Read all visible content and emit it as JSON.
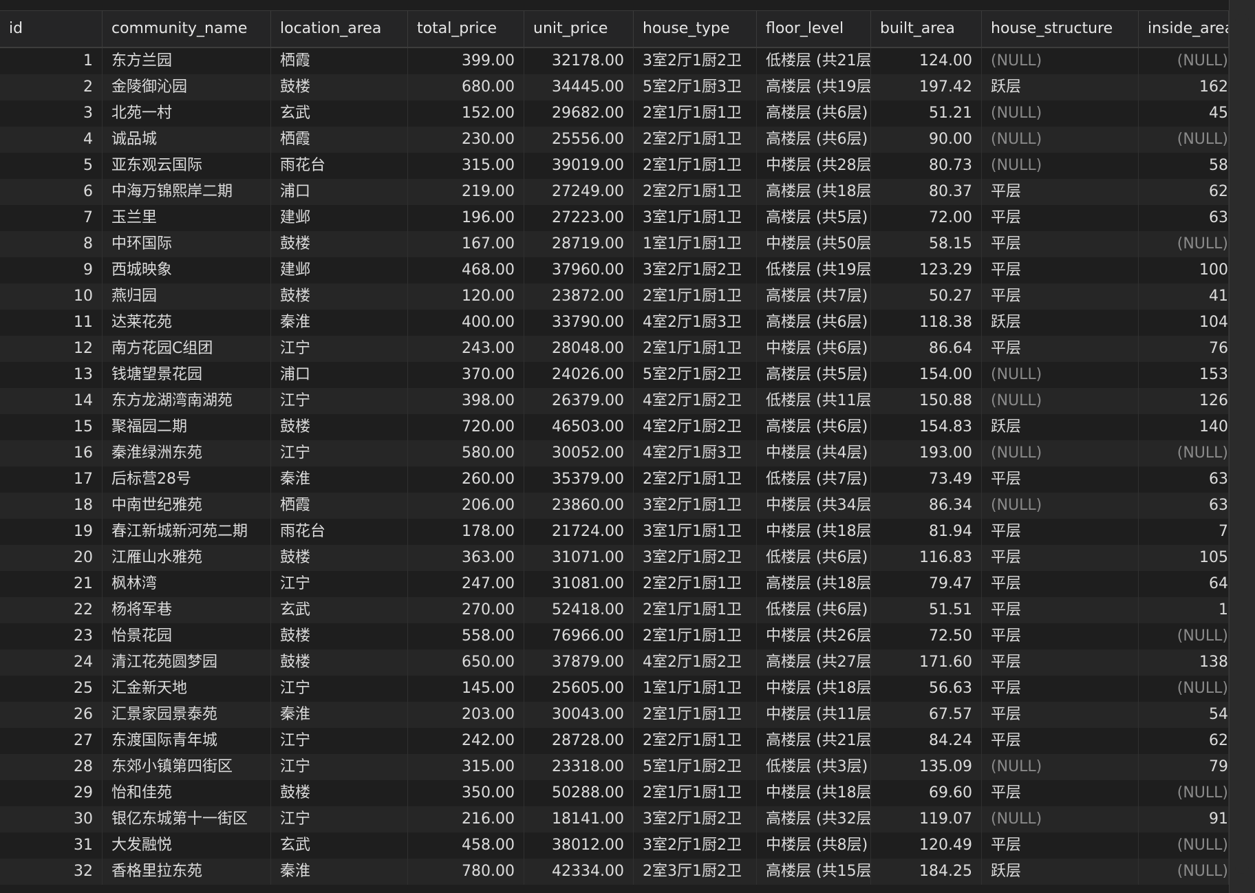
{
  "columns": [
    "id",
    "community_name",
    "location_area",
    "total_price",
    "unit_price",
    "house_type",
    "floor_level",
    "built_area",
    "house_structure",
    "inside_area"
  ],
  "rows": [
    [
      "1",
      "东方兰园",
      "栖霞",
      "399.00",
      "32178.00",
      "3室2厅1厨2卫",
      "低楼层 (共21层)",
      "124.00",
      "(NULL)",
      "(NULL)"
    ],
    [
      "2",
      "金陵御沁园",
      "鼓楼",
      "680.00",
      "34445.00",
      "5室2厅1厨3卫",
      "高楼层 (共19层)",
      "197.42",
      "跃层",
      "162"
    ],
    [
      "3",
      "北苑一村",
      "玄武",
      "152.00",
      "29682.00",
      "2室1厅1厨1卫",
      "高楼层 (共6层)",
      "51.21",
      "(NULL)",
      "45"
    ],
    [
      "4",
      "诚品城",
      "栖霞",
      "230.00",
      "25556.00",
      "2室2厅1厨1卫",
      "高楼层 (共6层)",
      "90.00",
      "(NULL)",
      "(NULL)"
    ],
    [
      "5",
      "亚东观云国际",
      "雨花台",
      "315.00",
      "39019.00",
      "2室1厅1厨1卫",
      "中楼层 (共28层)",
      "80.73",
      "(NULL)",
      "58"
    ],
    [
      "6",
      "中海万锦熙岸二期",
      "浦口",
      "219.00",
      "27249.00",
      "2室2厅1厨1卫",
      "高楼层 (共18层)",
      "80.37",
      "平层",
      "62"
    ],
    [
      "7",
      "玉兰里",
      "建邺",
      "196.00",
      "27223.00",
      "3室1厅1厨1卫",
      "高楼层 (共5层)",
      "72.00",
      "平层",
      "63"
    ],
    [
      "8",
      "中环国际",
      "鼓楼",
      "167.00",
      "28719.00",
      "1室1厅1厨1卫",
      "中楼层 (共50层)",
      "58.15",
      "平层",
      "(NULL)"
    ],
    [
      "9",
      "西城映象",
      "建邺",
      "468.00",
      "37960.00",
      "3室2厅1厨2卫",
      "低楼层 (共19层)",
      "123.29",
      "平层",
      "100"
    ],
    [
      "10",
      "燕归园",
      "鼓楼",
      "120.00",
      "23872.00",
      "2室1厅1厨1卫",
      "高楼层 (共7层)",
      "50.27",
      "平层",
      "41"
    ],
    [
      "11",
      "达莱花苑",
      "秦淮",
      "400.00",
      "33790.00",
      "4室2厅1厨3卫",
      "高楼层 (共6层)",
      "118.38",
      "跃层",
      "104"
    ],
    [
      "12",
      "南方花园C组团",
      "江宁",
      "243.00",
      "28048.00",
      "2室1厅1厨1卫",
      "中楼层 (共6层)",
      "86.64",
      "平层",
      "76"
    ],
    [
      "13",
      "钱塘望景花园",
      "浦口",
      "370.00",
      "24026.00",
      "5室2厅1厨2卫",
      "高楼层 (共5层)",
      "154.00",
      "(NULL)",
      "153"
    ],
    [
      "14",
      "东方龙湖湾南湖苑",
      "江宁",
      "398.00",
      "26379.00",
      "4室2厅1厨2卫",
      "低楼层 (共11层)",
      "150.88",
      "(NULL)",
      "126"
    ],
    [
      "15",
      "聚福园二期",
      "鼓楼",
      "720.00",
      "46503.00",
      "4室2厅1厨2卫",
      "高楼层 (共6层)",
      "154.83",
      "跃层",
      "140"
    ],
    [
      "16",
      "秦淮绿洲东苑",
      "江宁",
      "580.00",
      "30052.00",
      "4室2厅1厨3卫",
      "中楼层 (共4层)",
      "193.00",
      "(NULL)",
      "(NULL)"
    ],
    [
      "17",
      "后标营28号",
      "秦淮",
      "260.00",
      "35379.00",
      "2室2厅1厨1卫",
      "低楼层 (共7层)",
      "73.49",
      "平层",
      "63"
    ],
    [
      "18",
      "中南世纪雅苑",
      "栖霞",
      "206.00",
      "23860.00",
      "3室2厅1厨1卫",
      "中楼层 (共34层)",
      "86.34",
      "(NULL)",
      "63"
    ],
    [
      "19",
      "春江新城新河苑二期",
      "雨花台",
      "178.00",
      "21724.00",
      "3室1厅1厨1卫",
      "中楼层 (共18层)",
      "81.94",
      "平层",
      "7"
    ],
    [
      "20",
      "江雁山水雅苑",
      "鼓楼",
      "363.00",
      "31071.00",
      "3室2厅1厨2卫",
      "低楼层 (共6层)",
      "116.83",
      "平层",
      "105"
    ],
    [
      "21",
      "枫林湾",
      "江宁",
      "247.00",
      "31081.00",
      "2室2厅1厨1卫",
      "高楼层 (共18层)",
      "79.47",
      "平层",
      "64"
    ],
    [
      "22",
      "杨将军巷",
      "玄武",
      "270.00",
      "52418.00",
      "2室1厅1厨1卫",
      "低楼层 (共6层)",
      "51.51",
      "平层",
      "1"
    ],
    [
      "23",
      "怡景花园",
      "鼓楼",
      "558.00",
      "76966.00",
      "2室1厅1厨1卫",
      "中楼层 (共26层)",
      "72.50",
      "平层",
      "(NULL)"
    ],
    [
      "24",
      "清江花苑圆梦园",
      "鼓楼",
      "650.00",
      "37879.00",
      "4室2厅1厨2卫",
      "高楼层 (共27层)",
      "171.60",
      "平层",
      "138"
    ],
    [
      "25",
      "汇金新天地",
      "江宁",
      "145.00",
      "25605.00",
      "1室1厅1厨1卫",
      "中楼层 (共18层)",
      "56.63",
      "平层",
      "(NULL)"
    ],
    [
      "26",
      "汇景家园景泰苑",
      "秦淮",
      "203.00",
      "30043.00",
      "2室1厅1厨1卫",
      "中楼层 (共11层)",
      "67.57",
      "平层",
      "54"
    ],
    [
      "27",
      "东渡国际青年城",
      "江宁",
      "242.00",
      "28728.00",
      "2室2厅1厨1卫",
      "高楼层 (共21层)",
      "84.24",
      "平层",
      "62"
    ],
    [
      "28",
      "东郊小镇第四街区",
      "江宁",
      "315.00",
      "23318.00",
      "5室1厅1厨2卫",
      "低楼层 (共3层)",
      "135.09",
      "(NULL)",
      "79"
    ],
    [
      "29",
      "怡和佳苑",
      "鼓楼",
      "350.00",
      "50288.00",
      "2室1厅1厨1卫",
      "中楼层 (共18层)",
      "69.60",
      "平层",
      "(NULL)"
    ],
    [
      "30",
      "银亿东城第十一街区",
      "江宁",
      "216.00",
      "18141.00",
      "3室2厅1厨2卫",
      "高楼层 (共32层)",
      "119.07",
      "(NULL)",
      "91"
    ],
    [
      "31",
      "大发融悦",
      "玄武",
      "458.00",
      "38012.00",
      "3室2厅1厨2卫",
      "中楼层 (共8层)",
      "120.49",
      "平层",
      "(NULL)"
    ],
    [
      "32",
      "香格里拉东苑",
      "秦淮",
      "780.00",
      "42334.00",
      "2室3厅1厨2卫",
      "高楼层 (共15层)",
      "184.25",
      "跃层",
      "(NULL)"
    ]
  ]
}
